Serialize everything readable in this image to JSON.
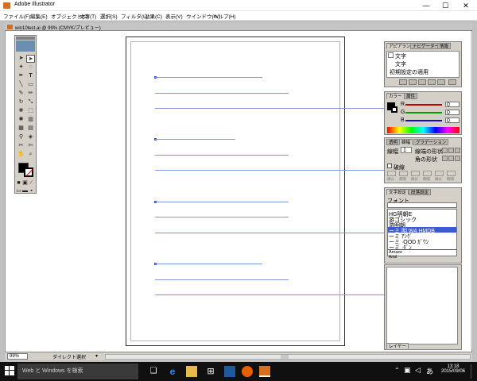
{
  "window": {
    "title": "Adobe Illustrator",
    "minimize": "—",
    "maximize": "☐",
    "close": "✕"
  },
  "menu": [
    "ファイル(F)",
    "編集(E)",
    "オブジェクト(O)",
    "文字(T)",
    "選択(S)",
    "フィルタ(L)",
    "効果(C)",
    "表示(V)",
    "ウインドウ(W)",
    "ヘルプ(H)"
  ],
  "document": {
    "title": "win10test.ai @ 99% (CMYK/プレビュー)"
  },
  "appearance_panel": {
    "tabs": [
      "アピアランス",
      "ナビゲーター",
      "情報"
    ],
    "items": [
      "文字",
      "文字",
      "初期設定の適用"
    ]
  },
  "color_panel": {
    "tabs": [
      "カラー",
      "属性"
    ],
    "rows": [
      {
        "label": "R",
        "value": "0",
        "color": "#c00000"
      },
      {
        "label": "G",
        "value": "0",
        "color": "#00a000"
      },
      {
        "label": "B",
        "value": "0",
        "color": "#1010c0"
      }
    ]
  },
  "stroke_panel": {
    "tabs": [
      "透明",
      "線幅",
      "グラデーション"
    ],
    "weight_label": "線幅",
    "weight_value": "1",
    "cap_label": "線端の形状",
    "join_label": "角の形状",
    "dash_label": "破線",
    "dash_fields": [
      "線分",
      "間隔",
      "線分",
      "間隔",
      "線分",
      "間隔"
    ]
  },
  "character_panel": {
    "tabs": [
      "文字設定",
      "段落設定"
    ],
    "font_label": "フォント",
    "font_list": [
      "HG明朝E",
      "游ゴシック",
      "游明朝",
      "ーミ  明 W4 HMDB",
      "ーミ  ｱﾝｸﾞ",
      "ーミ  ·OOD ｶﾞｳﾝ",
      "ーミ  ·ﾀﾞﾝ",
      "Amaze",
      "Arial"
    ],
    "selected_index": 3
  },
  "layers_panel": {
    "tab": "レイヤー"
  },
  "statusbar": {
    "zoom": "99%",
    "tool": "ダイレクト選択"
  },
  "taskbar": {
    "search_placeholder": "Web と Windows を検索",
    "time": "13:18",
    "date": "2015/09/06",
    "ime": "あ"
  },
  "colors": {
    "guide": "#7c96e0",
    "accent": "#3b5bd0"
  }
}
